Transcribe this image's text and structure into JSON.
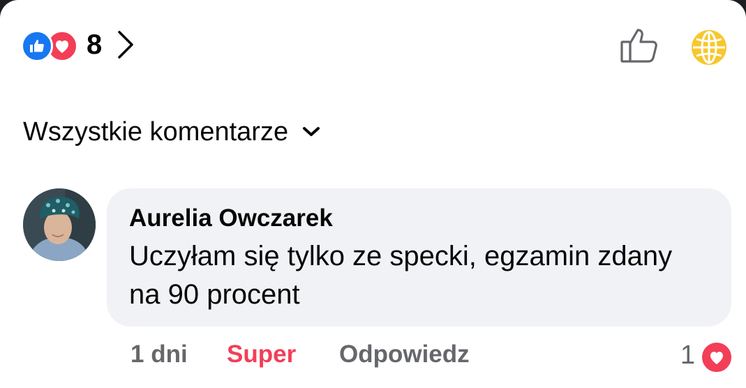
{
  "reactions": {
    "count": "8",
    "like_icon": "thumbs-up-icon",
    "love_icon": "heart-icon",
    "like_color": "#1877f2",
    "love_color": "#f33e58"
  },
  "header_actions": {
    "like_icon": "thumbs-up-outline-icon",
    "globe_icon": "globe-icon",
    "globe_color": "#f7c72c"
  },
  "sort": {
    "label": "Wszystkie komentarze",
    "icon": "chevron-down-icon"
  },
  "comment": {
    "author": "Aurelia Owczarek",
    "text": "Uczyłam się tylko ze specki, egzamin zdany na 90 procent",
    "time": "1 dni",
    "reaction_label": "Super",
    "reply_label": "Odpowiedz",
    "reaction_count": "1",
    "reaction_icon": "heart-icon"
  }
}
